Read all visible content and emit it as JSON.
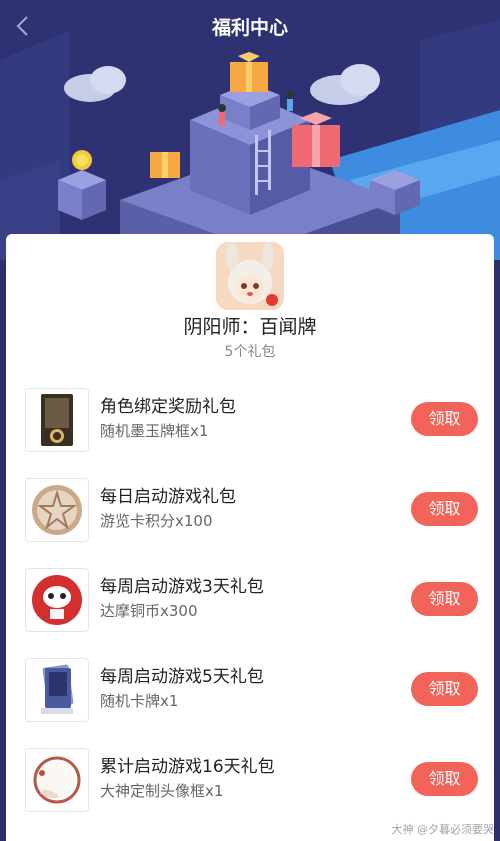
{
  "header": {
    "title": "福利中心"
  },
  "game": {
    "name": "阴阳师：百闻牌",
    "pack_count": "5个礼包"
  },
  "packs": [
    {
      "title": "角色绑定奖励礼包",
      "desc": "随机墨玉牌框x1",
      "button": "领取"
    },
    {
      "title": "每日启动游戏礼包",
      "desc": "游览卡积分x100",
      "button": "领取"
    },
    {
      "title": "每周启动游戏3天礼包",
      "desc": "达摩铜币x300",
      "button": "领取"
    },
    {
      "title": "每周启动游戏5天礼包",
      "desc": "随机卡牌x1",
      "button": "领取"
    },
    {
      "title": "累计启动游戏16天礼包",
      "desc": "大神定制头像框x1",
      "button": "领取"
    }
  ],
  "watermark": "大神 @夕暮必须要哭",
  "colors": {
    "accent": "#f2645a",
    "hero_bg": "#2d3170"
  }
}
